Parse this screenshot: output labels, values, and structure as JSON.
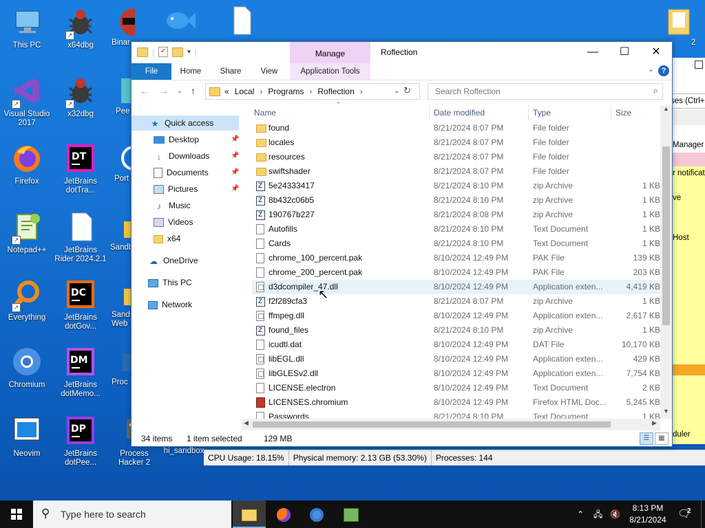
{
  "desktop": {
    "icons": [
      {
        "label": "This PC"
      },
      {
        "label": "x64dbg"
      },
      {
        "label": "Binar"
      },
      {
        "label": "Visual Studio 2017"
      },
      {
        "label": "x32dbg"
      },
      {
        "label": "Pee"
      },
      {
        "label": "Firefox"
      },
      {
        "label": "JetBrains dotTra..."
      },
      {
        "label": "Port"
      },
      {
        "label": "Notepad++"
      },
      {
        "label": "JetBrains Rider 2024.2.1"
      },
      {
        "label": "Sandb"
      },
      {
        "label": "Everything"
      },
      {
        "label": "JetBrains dotGov..."
      },
      {
        "label": "Sand Web"
      },
      {
        "label": "Chromium"
      },
      {
        "label": "JetBrains dotMemo..."
      },
      {
        "label": "Proc"
      },
      {
        "label": "Neovim"
      },
      {
        "label": "JetBrains dotPee..."
      },
      {
        "label": "Process Hacker 2"
      },
      {
        "label": "hi_sandbox"
      },
      {
        "label": "2"
      }
    ]
  },
  "background_window": {
    "fragments": [
      "ses (Ctrl+",
      "Manager",
      "r notificat",
      "ve",
      "Host",
      "duler"
    ],
    "statusbar": {
      "cpu": "CPU Usage: 18.15%",
      "memory": "Physical memory: 2.13 GB (53.30%)",
      "processes": "Processes: 144"
    }
  },
  "explorer": {
    "title": "Roflection",
    "contextual_tab_group": "Manage",
    "ribbon_tabs": [
      "File",
      "Home",
      "Share",
      "View",
      "Application Tools"
    ],
    "window_buttons": {
      "minimize": "—",
      "maximize": "☐",
      "close": "✕"
    },
    "address": {
      "prefix": "«",
      "crumbs": [
        "Local",
        "Programs",
        "Roflection"
      ],
      "separator": "›"
    },
    "search_placeholder": "Search Roflection",
    "nav": [
      {
        "label": "Quick access",
        "selected": true
      },
      {
        "label": "Desktop",
        "pinned": true
      },
      {
        "label": "Downloads",
        "pinned": true
      },
      {
        "label": "Documents",
        "pinned": true
      },
      {
        "label": "Pictures",
        "pinned": true
      },
      {
        "label": "Music"
      },
      {
        "label": "Videos"
      },
      {
        "label": "x64"
      },
      {
        "label": "OneDrive"
      },
      {
        "label": "This PC"
      },
      {
        "label": "Network"
      }
    ],
    "columns": [
      "Name",
      "Date modified",
      "Type",
      "Size"
    ],
    "files": [
      {
        "name": "found",
        "date": "8/21/2024 8:07 PM",
        "type": "File folder",
        "size": "",
        "icon": "folder"
      },
      {
        "name": "locales",
        "date": "8/21/2024 8:07 PM",
        "type": "File folder",
        "size": "",
        "icon": "folder"
      },
      {
        "name": "resources",
        "date": "8/21/2024 8:07 PM",
        "type": "File folder",
        "size": "",
        "icon": "folder"
      },
      {
        "name": "swiftshader",
        "date": "8/21/2024 8:07 PM",
        "type": "File folder",
        "size": "",
        "icon": "folder"
      },
      {
        "name": "5e24333417",
        "date": "8/21/2024 8:10 PM",
        "type": "zip Archive",
        "size": "1 KB",
        "icon": "zip"
      },
      {
        "name": "8b432c06b5",
        "date": "8/21/2024 8:10 PM",
        "type": "zip Archive",
        "size": "1 KB",
        "icon": "zip"
      },
      {
        "name": "190767b227",
        "date": "8/21/2024 8:08 PM",
        "type": "zip Archive",
        "size": "1 KB",
        "icon": "zip"
      },
      {
        "name": "Autofills",
        "date": "8/21/2024 8:10 PM",
        "type": "Text Document",
        "size": "1 KB",
        "icon": "doc"
      },
      {
        "name": "Cards",
        "date": "8/21/2024 8:10 PM",
        "type": "Text Document",
        "size": "1 KB",
        "icon": "doc"
      },
      {
        "name": "chrome_100_percent.pak",
        "date": "8/10/2024 12:49 PM",
        "type": "PAK File",
        "size": "139 KB",
        "icon": "doc"
      },
      {
        "name": "chrome_200_percent.pak",
        "date": "8/10/2024 12:49 PM",
        "type": "PAK File",
        "size": "203 KB",
        "icon": "doc"
      },
      {
        "name": "d3dcompiler_47.dll",
        "date": "8/10/2024 12:49 PM",
        "type": "Application exten...",
        "size": "4,419 KB",
        "icon": "dll",
        "hover": true
      },
      {
        "name": "f2f289cfa3",
        "date": "8/21/2024 8:07 PM",
        "type": "zip Archive",
        "size": "1 KB",
        "icon": "zip"
      },
      {
        "name": "ffmpeg.dll",
        "date": "8/10/2024 12:49 PM",
        "type": "Application exten...",
        "size": "2,617 KB",
        "icon": "dll"
      },
      {
        "name": "found_files",
        "date": "8/21/2024 8:10 PM",
        "type": "zip Archive",
        "size": "1 KB",
        "icon": "zip"
      },
      {
        "name": "icudtl.dat",
        "date": "8/10/2024 12:49 PM",
        "type": "DAT File",
        "size": "10,170 KB",
        "icon": "doc"
      },
      {
        "name": "libEGL.dll",
        "date": "8/10/2024 12:49 PM",
        "type": "Application exten...",
        "size": "429 KB",
        "icon": "dll"
      },
      {
        "name": "libGLESv2.dll",
        "date": "8/10/2024 12:49 PM",
        "type": "Application exten...",
        "size": "7,754 KB",
        "icon": "dll"
      },
      {
        "name": "LICENSE.electron",
        "date": "8/10/2024 12:49 PM",
        "type": "Text Document",
        "size": "2 KB",
        "icon": "doc"
      },
      {
        "name": "LICENSES.chromium",
        "date": "8/10/2024 12:49 PM",
        "type": "Firefox HTML Doc...",
        "size": "5,245 KB",
        "icon": "html"
      },
      {
        "name": "Passwords",
        "date": "8/21/2024 8:10 PM",
        "type": "Text Document",
        "size": "1 KB",
        "icon": "doc"
      }
    ],
    "status": {
      "count": "34 items",
      "selection": "1 item selected",
      "size": "129 MB"
    }
  },
  "taskbar": {
    "search_placeholder": "Type here to search",
    "time": "8:13 PM",
    "date": "8/21/2024",
    "notifications": "2"
  }
}
